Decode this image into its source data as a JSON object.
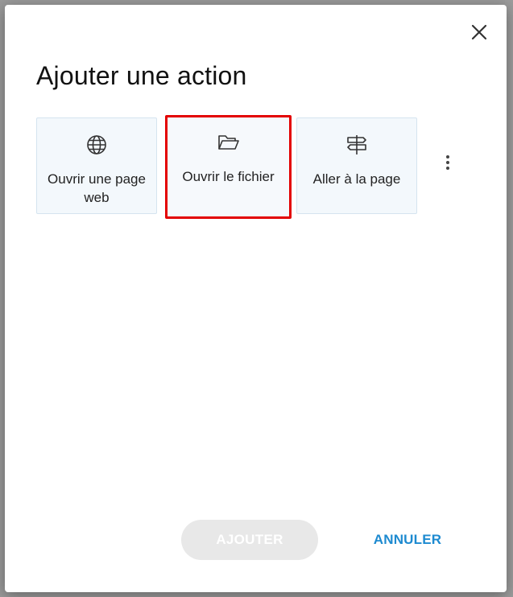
{
  "dialog": {
    "title": "Ajouter une action",
    "close_icon": "close-icon",
    "actions": [
      {
        "label": "Ouvrir une page web",
        "icon": "globe-icon"
      },
      {
        "label": "Ouvrir le fichier",
        "icon": "folder-open-icon",
        "selected": true
      },
      {
        "label": "Aller à la page",
        "icon": "signpost-icon"
      }
    ],
    "more_icon": "more-vertical-icon",
    "add_label": "AJOUTER",
    "cancel_label": "ANNULER"
  },
  "colors": {
    "highlight": "#e30000",
    "accent": "#1d8ad0",
    "card_bg": "#f3f8fc",
    "disabled_bg": "#e8e8e8"
  }
}
